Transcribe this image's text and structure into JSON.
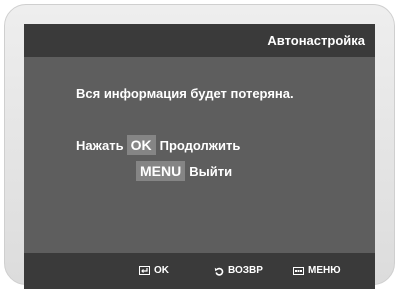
{
  "screen": {
    "title": "Автонастройка",
    "warning": "Вся информация будет потеряна.",
    "action_continue": {
      "prefix": "Нажать",
      "key": "OK",
      "label": "Продолжить"
    },
    "action_exit": {
      "key": "MENU",
      "label": "Выйти"
    }
  },
  "bottom_bar": {
    "ok_label": "OK",
    "back_label": "ВОЗВР",
    "menu_label": "МЕНЮ",
    "icons": [
      "enter-icon",
      "return-icon",
      "menu-icon"
    ]
  },
  "colors": {
    "screen_bg": "#5e5e5e",
    "bar_bg": "#3a3a3a",
    "key_bg": "#858585",
    "text": "#ffffff"
  }
}
